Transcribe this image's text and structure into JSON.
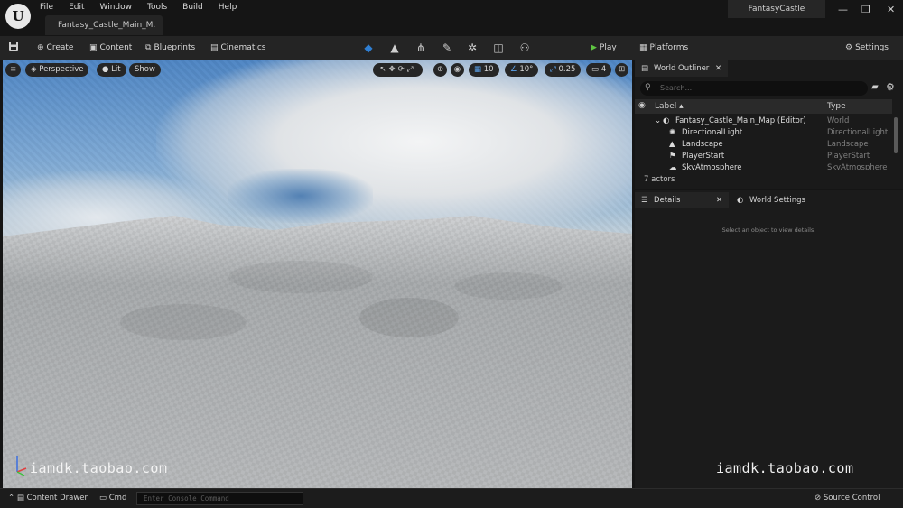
{
  "menu": [
    "File",
    "Edit",
    "Window",
    "Tools",
    "Build",
    "Help"
  ],
  "level_tab": "Fantasy_Castle_Main_M.",
  "project_name": "FantasyCastle",
  "window_controls": {
    "minimize": "—",
    "restore": "❐",
    "close": "✕"
  },
  "toolbar": {
    "create": "Create",
    "content": "Content",
    "blueprints": "Blueprints",
    "cinematics": "Cinematics",
    "play": "Play",
    "platforms": "Platforms",
    "settings": "Settings"
  },
  "viewport": {
    "perspective": "Perspective",
    "lit": "Lit",
    "show": "Show",
    "grid_snap": "10",
    "rotation_snap": "10°",
    "scale_snap": "0.25",
    "camera_speed": "4"
  },
  "outliner": {
    "title": "World Outliner",
    "search_placeholder": "Search...",
    "col_label": "Label",
    "col_type": "Type",
    "rows": [
      {
        "label": "Fantasy_Castle_Main_Map (Editor)",
        "type": "World"
      },
      {
        "label": "DirectionalLight",
        "type": "DirectionalLight"
      },
      {
        "label": "Landscape",
        "type": "Landscape"
      },
      {
        "label": "PlayerStart",
        "type": "PlayerStart"
      },
      {
        "label": "SkyAtmosphere",
        "type": "SkyAtmosphere"
      }
    ],
    "actor_count": "7 actors"
  },
  "details": {
    "tab_details": "Details",
    "tab_world_settings": "World Settings",
    "empty_message": "Select an object to view details."
  },
  "statusbar": {
    "content_drawer": "Content Drawer",
    "cmd": "Cmd",
    "console_placeholder": "Enter Console Command",
    "source_control": "Source Control"
  },
  "watermark": "iamdk.taobao.com",
  "colors": {
    "accent_blue": "#2f7fd3",
    "play_green": "#5fc542",
    "panel_bg": "#1a1a1a"
  }
}
